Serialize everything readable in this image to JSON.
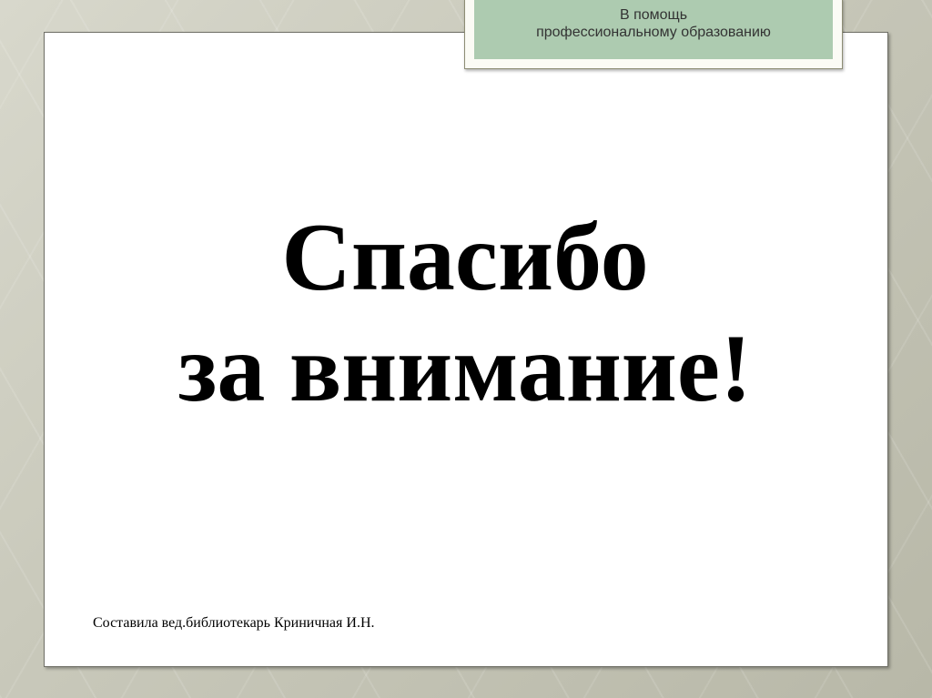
{
  "header": {
    "line1": "В помощь",
    "line2": "профессиональному образованию"
  },
  "title": {
    "line1": "Спасибо",
    "line2": "за внимание!"
  },
  "author": "Составила вед.библиотекарь Криничная И.Н."
}
